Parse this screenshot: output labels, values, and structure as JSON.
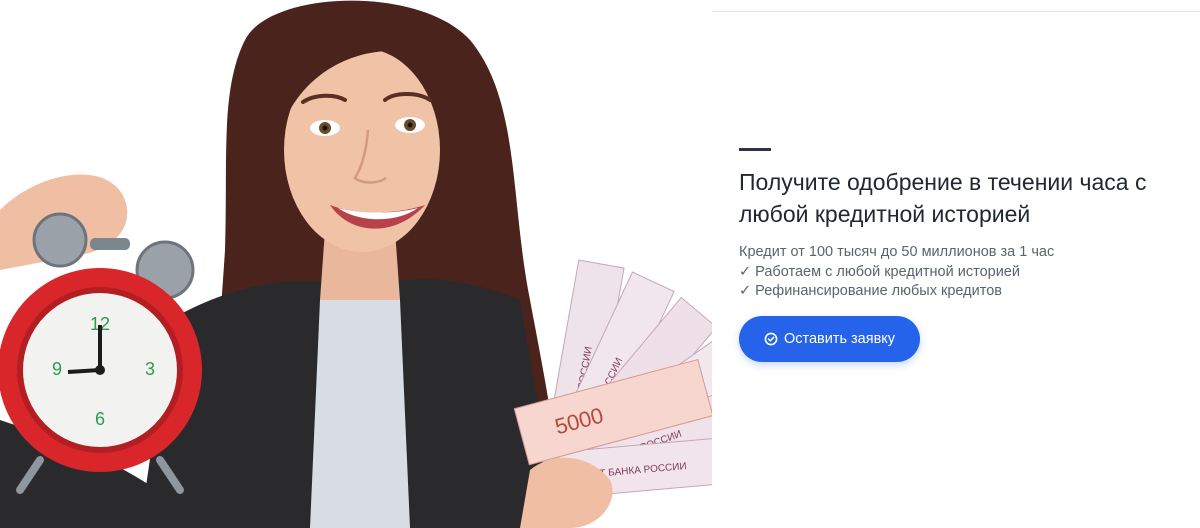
{
  "hero": {
    "image_alt": "Smiling woman holding an alarm clock and a fan of 5000 ruble banknotes",
    "banknote_text": "5000",
    "banknote_bank_text": "БИЛЕТ БАНКА РОССИИ"
  },
  "offer": {
    "title": "Получите одобрение в течении часа с любой кредитной историей",
    "lines": [
      "Кредит от 100 тысяч до 50 миллионов за 1 час",
      "✓ Работаем с любой кредитной историей",
      "✓ Рефинансирование любых кредитов"
    ],
    "button_label": "Оставить заявку",
    "button_icon": "check-circle-icon"
  },
  "colors": {
    "accent": "#2563eb",
    "heading": "#222831",
    "text": "#5b636d"
  }
}
